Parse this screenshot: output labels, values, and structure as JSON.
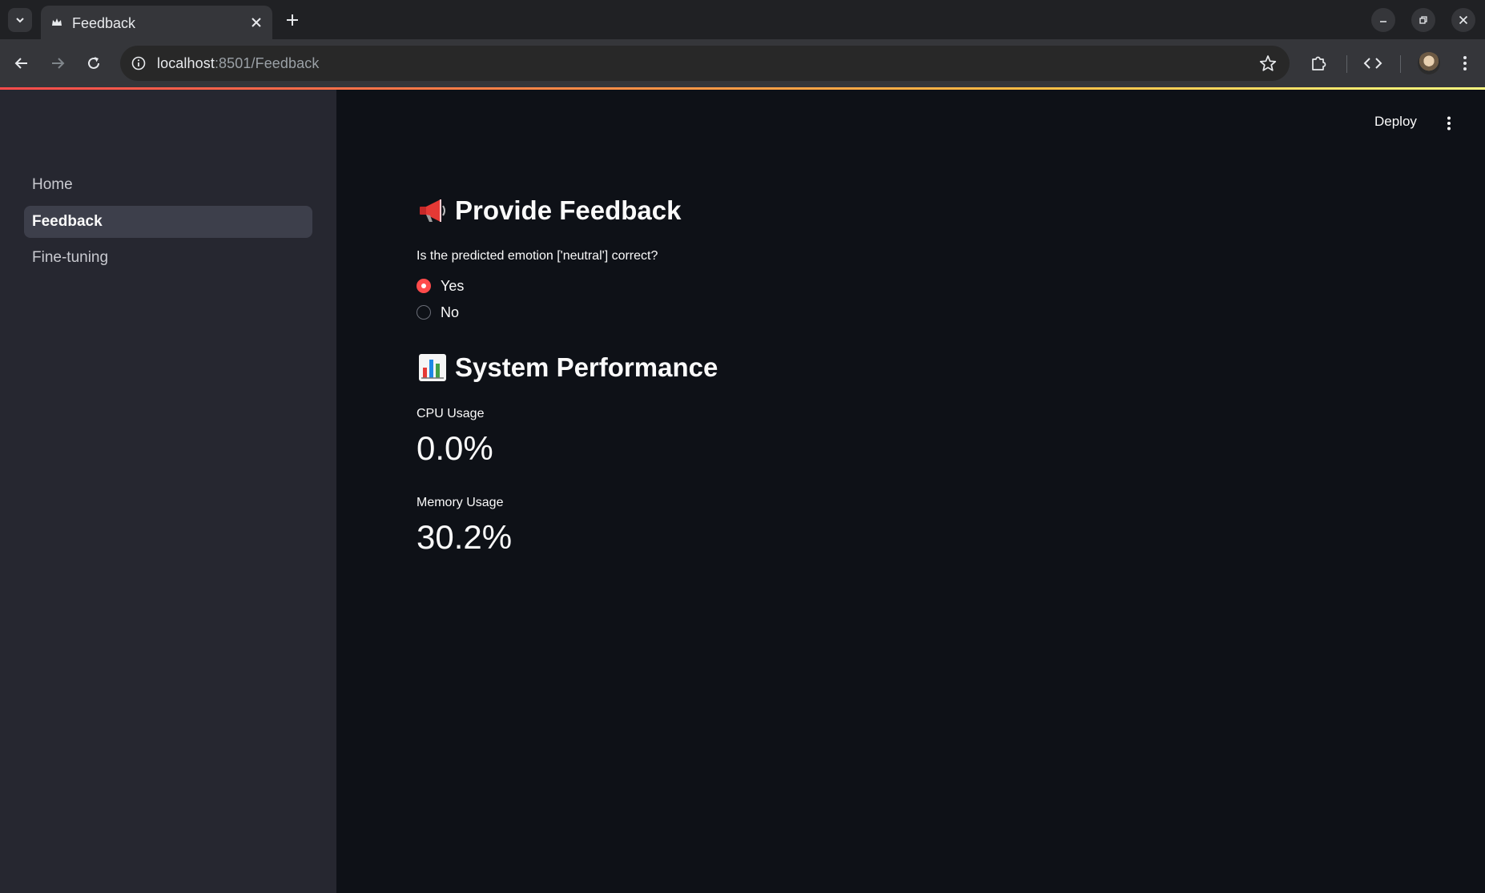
{
  "browser": {
    "tab_title": "Feedback",
    "url_host": "localhost",
    "url_rest": ":8501/Feedback"
  },
  "header": {
    "deploy_label": "Deploy"
  },
  "sidebar": {
    "items": [
      {
        "label": "Home",
        "active": false
      },
      {
        "label": "Feedback",
        "active": true
      },
      {
        "label": "Fine-tuning",
        "active": false
      }
    ]
  },
  "feedback": {
    "title": "Provide Feedback",
    "title_icon": "megaphone-icon",
    "question": "Is the predicted emotion ['neutral'] correct?",
    "options": [
      "Yes",
      "No"
    ],
    "selected": "Yes"
  },
  "performance": {
    "title": "System Performance",
    "title_icon": "bar-chart-icon",
    "cpu_label": "CPU Usage",
    "cpu_value": "0.0%",
    "memory_label": "Memory Usage",
    "memory_value": "30.2%"
  },
  "colors": {
    "accent": "#ff4b4b",
    "background": "#0e1117",
    "sidebar": "#262730"
  }
}
